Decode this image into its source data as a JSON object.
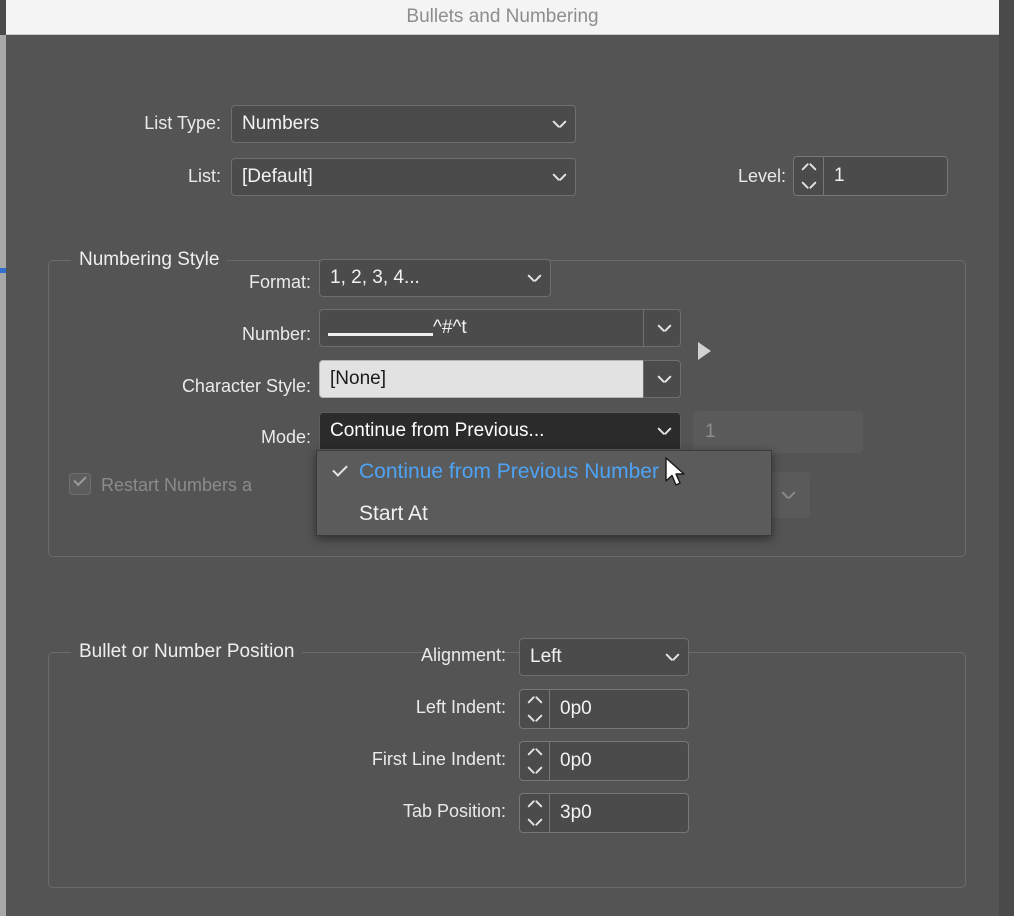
{
  "window": {
    "title": "Bullets and Numbering"
  },
  "top": {
    "list_type_label": "List Type:",
    "list_type_value": "Numbers",
    "list_label": "List:",
    "list_value": "[Default]",
    "level_label": "Level:",
    "level_value": "1"
  },
  "numbering_style": {
    "group_title": "Numbering Style",
    "format_label": "Format:",
    "format_value": "1, 2, 3, 4...",
    "number_label": "Number:",
    "number_value": "^#^t",
    "number_insert_icon": "play-triangle-icon",
    "character_style_label": "Character Style:",
    "character_style_value": "[None]",
    "mode_label": "Mode:",
    "mode_value": "Continue from Previous...",
    "start_at_value": "1",
    "restart_label": "Restart Numbers a",
    "restart_checked": true
  },
  "mode_dropdown": {
    "items": [
      {
        "label": "Continue from Previous Number",
        "checked": true
      },
      {
        "label": "Start At",
        "checked": false
      }
    ]
  },
  "position": {
    "group_title": "Bullet or Number Position",
    "alignment_label": "Alignment:",
    "alignment_value": "Left",
    "left_indent_label": "Left Indent:",
    "left_indent_value": "0p0",
    "first_line_indent_label": "First Line Indent:",
    "first_line_indent_value": "0p0",
    "tab_position_label": "Tab Position:",
    "tab_position_value": "3p0"
  },
  "colors": {
    "dialog_bg": "#545454",
    "titlebar_bg": "#f4f4f4",
    "accent_blue": "#4da3f5",
    "edge_accent": "#2f6fd0",
    "field_bg": "#4b4b4b",
    "light_field_bg": "#e2e2e2"
  }
}
